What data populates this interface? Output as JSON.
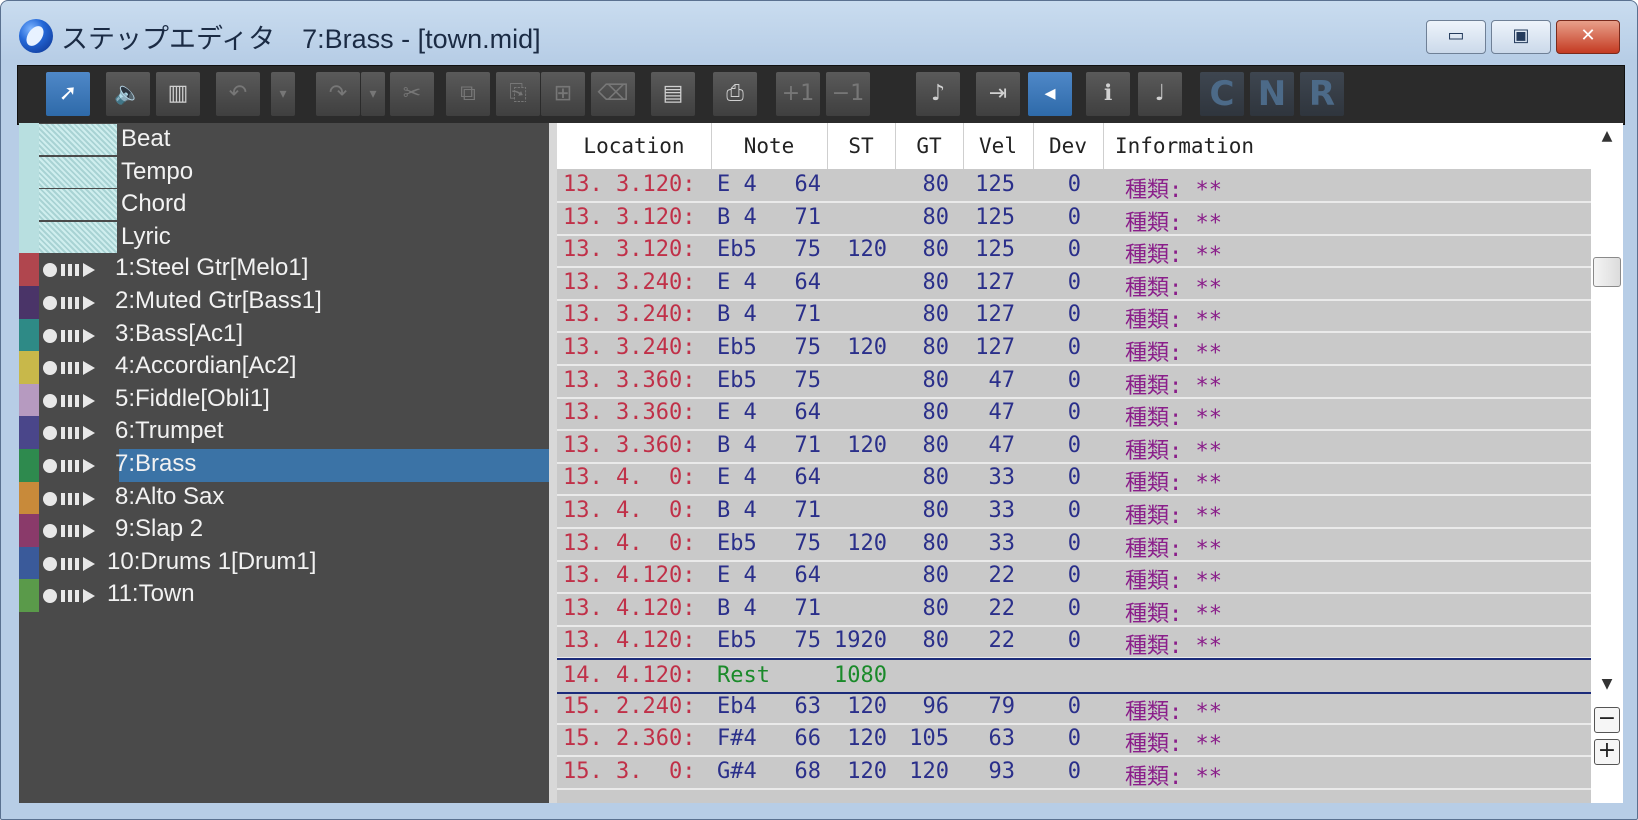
{
  "window": {
    "title": "ステップエディタ　7:Brass - [town.mid]",
    "min_label": "▭",
    "max_label": "▣",
    "close_label": "✕"
  },
  "toolbar": {
    "buttons": [
      {
        "name": "select-tool-button",
        "glyph": "➚",
        "active": true
      },
      {
        "name": "speaker-tool-button",
        "glyph": "🔈"
      },
      {
        "name": "keyboard-tool-button",
        "glyph": "▥"
      },
      {
        "name": "undo-button",
        "glyph": "↶",
        "dim": true
      },
      {
        "name": "undo-dropdown-button",
        "glyph": "▾",
        "dim": true,
        "narrow": true
      },
      {
        "name": "redo-button",
        "glyph": "↷",
        "dim": true
      },
      {
        "name": "redo-dropdown-button",
        "glyph": "▾",
        "dim": true,
        "narrow": true
      },
      {
        "name": "cut-button",
        "glyph": "✂",
        "dim": true
      },
      {
        "name": "copy-button",
        "glyph": "⧉",
        "dim": true
      },
      {
        "name": "paste-button",
        "glyph": "⎘",
        "dim": true
      },
      {
        "name": "paste-insert-button",
        "glyph": "⊞",
        "dim": true
      },
      {
        "name": "erase-button",
        "glyph": "⌫",
        "dim": true
      },
      {
        "name": "insert-event-button",
        "glyph": "▤"
      },
      {
        "name": "print-button",
        "glyph": "⎙"
      },
      {
        "name": "increment-button",
        "glyph": "+1",
        "dim": true
      },
      {
        "name": "decrement-button",
        "glyph": "−1",
        "dim": true
      },
      {
        "name": "add-note-button",
        "glyph": "♪"
      },
      {
        "name": "goto-location-button",
        "glyph": "⇥"
      },
      {
        "name": "auto-scroll-button",
        "glyph": "◂",
        "active": true
      },
      {
        "name": "info-note-button",
        "glyph": "ℹ"
      },
      {
        "name": "note-display-button",
        "glyph": "♩"
      },
      {
        "name": "c-filter-button",
        "glyph": "C",
        "letter": true
      },
      {
        "name": "n-filter-button",
        "glyph": "N",
        "letter": true
      },
      {
        "name": "r-filter-button",
        "glyph": "R",
        "letter": true
      }
    ]
  },
  "system_tracks": [
    {
      "label": "Beat"
    },
    {
      "label": "Tempo"
    },
    {
      "label": "Chord"
    },
    {
      "label": "Lyric"
    }
  ],
  "tracks": [
    {
      "label": "1:Steel Gtr[Melo1]",
      "color": "#b0464e"
    },
    {
      "label": "2:Muted Gtr[Bass1]",
      "color": "#4a3468"
    },
    {
      "label": "3:Bass[Ac1]",
      "color": "#2e8a86"
    },
    {
      "label": "4:Accordian[Ac2]",
      "color": "#c8b84a"
    },
    {
      "label": "5:Fiddle[Obli1]",
      "color": "#b69ac0"
    },
    {
      "label": "6:Trumpet",
      "color": "#4a468a"
    },
    {
      "label": "7:Brass",
      "color": "#2e8a4e",
      "selected": true
    },
    {
      "label": "8:Alto Sax",
      "color": "#c88a3a"
    },
    {
      "label": "9:Slap 2",
      "color": "#8a3a6a"
    },
    {
      "label": "10:Drums 1[Drum1]",
      "color": "#3a5a9a"
    },
    {
      "label": "11:Town",
      "color": "#5a9a4a"
    }
  ],
  "event_list": {
    "headers": [
      "Location",
      "Note",
      "ST",
      "GT",
      "Vel",
      "Dev",
      "Information"
    ],
    "rows": [
      {
        "loc": "13. 3.120:",
        "note": "E 4",
        "num": "64",
        "st": "",
        "gt": "80",
        "vel": "125",
        "dev": "0",
        "info": "種類: **"
      },
      {
        "loc": "13. 3.120:",
        "note": "B 4",
        "num": "71",
        "st": "",
        "gt": "80",
        "vel": "125",
        "dev": "0",
        "info": "種類: **"
      },
      {
        "loc": "13. 3.120:",
        "note": "Eb5",
        "num": "75",
        "st": "120",
        "gt": "80",
        "vel": "125",
        "dev": "0",
        "info": "種類: **"
      },
      {
        "loc": "13. 3.240:",
        "note": "E 4",
        "num": "64",
        "st": "",
        "gt": "80",
        "vel": "127",
        "dev": "0",
        "info": "種類: **"
      },
      {
        "loc": "13. 3.240:",
        "note": "B 4",
        "num": "71",
        "st": "",
        "gt": "80",
        "vel": "127",
        "dev": "0",
        "info": "種類: **"
      },
      {
        "loc": "13. 3.240:",
        "note": "Eb5",
        "num": "75",
        "st": "120",
        "gt": "80",
        "vel": "127",
        "dev": "0",
        "info": "種類: **"
      },
      {
        "loc": "13. 3.360:",
        "note": "Eb5",
        "num": "75",
        "st": "",
        "gt": "80",
        "vel": "47",
        "dev": "0",
        "info": "種類: **"
      },
      {
        "loc": "13. 3.360:",
        "note": "E 4",
        "num": "64",
        "st": "",
        "gt": "80",
        "vel": "47",
        "dev": "0",
        "info": "種類: **"
      },
      {
        "loc": "13. 3.360:",
        "note": "B 4",
        "num": "71",
        "st": "120",
        "gt": "80",
        "vel": "47",
        "dev": "0",
        "info": "種類: **"
      },
      {
        "loc": "13. 4.  0:",
        "note": "E 4",
        "num": "64",
        "st": "",
        "gt": "80",
        "vel": "33",
        "dev": "0",
        "info": "種類: **"
      },
      {
        "loc": "13. 4.  0:",
        "note": "B 4",
        "num": "71",
        "st": "",
        "gt": "80",
        "vel": "33",
        "dev": "0",
        "info": "種類: **"
      },
      {
        "loc": "13. 4.  0:",
        "note": "Eb5",
        "num": "75",
        "st": "120",
        "gt": "80",
        "vel": "33",
        "dev": "0",
        "info": "種類: **"
      },
      {
        "loc": "13. 4.120:",
        "note": "E 4",
        "num": "64",
        "st": "",
        "gt": "80",
        "vel": "22",
        "dev": "0",
        "info": "種類: **"
      },
      {
        "loc": "13. 4.120:",
        "note": "B 4",
        "num": "71",
        "st": "",
        "gt": "80",
        "vel": "22",
        "dev": "0",
        "info": "種類: **"
      },
      {
        "loc": "13. 4.120:",
        "note": "Eb5",
        "num": "75",
        "st": "1920",
        "gt": "80",
        "vel": "22",
        "dev": "0",
        "info": "種類: **"
      },
      {
        "loc": "14. 4.120:",
        "note": "Rest",
        "num": "",
        "st": "1080",
        "gt": "",
        "vel": "",
        "dev": "",
        "info": "",
        "rest": true
      },
      {
        "loc": "15. 2.240:",
        "note": "Eb4",
        "num": "63",
        "st": "120",
        "gt": "96",
        "vel": "79",
        "dev": "0",
        "info": "種類: **"
      },
      {
        "loc": "15. 2.360:",
        "note": "F#4",
        "num": "66",
        "st": "120",
        "gt": "105",
        "vel": "63",
        "dev": "0",
        "info": "種類: **"
      },
      {
        "loc": "15. 3.  0:",
        "note": "G#4",
        "num": "68",
        "st": "120",
        "gt": "120",
        "vel": "93",
        "dev": "0",
        "info": "種類: **"
      }
    ]
  },
  "scrollbar": {
    "up_glyph": "▲",
    "down_glyph": "▼",
    "zoom_out_label": "−",
    "zoom_in_label": "+"
  }
}
